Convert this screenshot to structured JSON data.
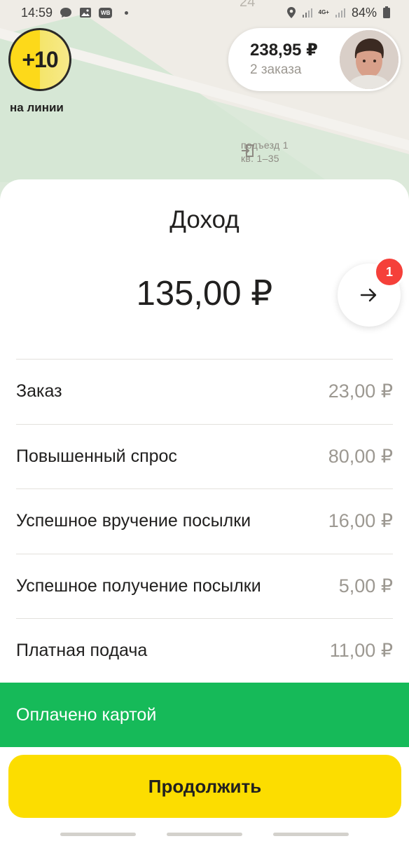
{
  "status_bar": {
    "time": "14:59",
    "wb_label": "WB",
    "network": "4G+",
    "battery": "84%"
  },
  "map": {
    "street_number": "24",
    "entrance_line1": "подъезд 1",
    "entrance_line2": "кв. 1–35"
  },
  "rating": {
    "value": "+10",
    "caption": "на линии"
  },
  "balance": {
    "amount": "238,95 ₽",
    "orders": "2 заказа"
  },
  "sheet": {
    "title": "Доход",
    "income": "135,00 ₽",
    "notification_count": "1",
    "rows": [
      {
        "label": "Заказ",
        "value": "23,00 ₽"
      },
      {
        "label": "Повышенный спрос",
        "value": "80,00 ₽"
      },
      {
        "label": "Успешное вручение посылки",
        "value": "16,00 ₽"
      },
      {
        "label": "Успешное получение посылки",
        "value": "5,00 ₽"
      },
      {
        "label": "Платная подача",
        "value": "11,00 ₽"
      }
    ],
    "paid_label": "Оплачено картой",
    "continue_label": "Продолжить"
  },
  "colors": {
    "accent_yellow": "#fcdd00",
    "paid_green": "#16ba59",
    "badge_red": "#f5403a"
  }
}
